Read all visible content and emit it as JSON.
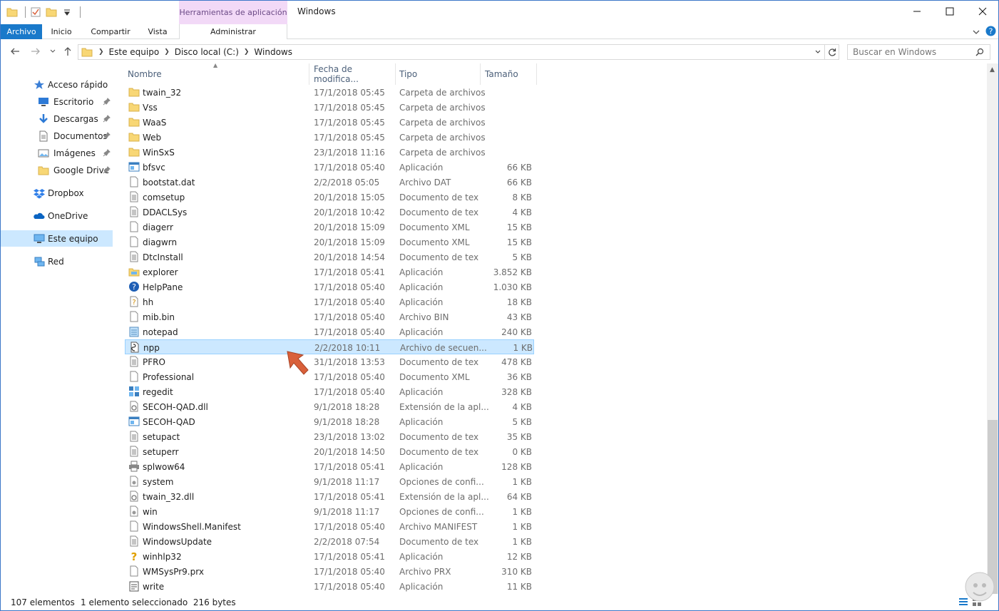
{
  "titlebar": {
    "context_tab": "Herramientas de aplicación",
    "title": "Windows"
  },
  "ribbon": {
    "tabs": [
      "Archivo",
      "Inicio",
      "Compartir",
      "Vista"
    ],
    "context_tab": "Administrar"
  },
  "address": {
    "crumbs": [
      "Este equipo",
      "Disco local (C:)",
      "Windows"
    ],
    "search_placeholder": "Buscar en Windows"
  },
  "nav": {
    "quick_access": "Acceso rápido",
    "items": [
      {
        "label": "Escritorio",
        "pinned": true,
        "icon": "desktop-icon"
      },
      {
        "label": "Descargas",
        "pinned": true,
        "icon": "download-icon"
      },
      {
        "label": "Documentos",
        "pinned": true,
        "icon": "documents-icon"
      },
      {
        "label": "Imágenes",
        "pinned": true,
        "icon": "pictures-icon"
      },
      {
        "label": "Google Drive",
        "pinned": true,
        "icon": "folder-icon"
      }
    ],
    "dropbox": "Dropbox",
    "onedrive": "OneDrive",
    "this_pc": "Este equipo",
    "network": "Red"
  },
  "columns": {
    "name": "Nombre",
    "date": "Fecha de modifica...",
    "type": "Tipo",
    "size": "Tamaño"
  },
  "files": [
    {
      "name": "twain_32",
      "date": "17/1/2018 05:45",
      "type": "Carpeta de archivos",
      "size": "",
      "icon": "folder"
    },
    {
      "name": "Vss",
      "date": "17/1/2018 05:45",
      "type": "Carpeta de archivos",
      "size": "",
      "icon": "folder"
    },
    {
      "name": "WaaS",
      "date": "17/1/2018 05:45",
      "type": "Carpeta de archivos",
      "size": "",
      "icon": "folder"
    },
    {
      "name": "Web",
      "date": "17/1/2018 05:45",
      "type": "Carpeta de archivos",
      "size": "",
      "icon": "folder"
    },
    {
      "name": "WinSxS",
      "date": "23/1/2018 11:16",
      "type": "Carpeta de archivos",
      "size": "",
      "icon": "folder"
    },
    {
      "name": "bfsvc",
      "date": "17/1/2018 05:40",
      "type": "Aplicación",
      "size": "66 KB",
      "icon": "app"
    },
    {
      "name": "bootstat.dat",
      "date": "2/2/2018 05:05",
      "type": "Archivo DAT",
      "size": "66 KB",
      "icon": "file"
    },
    {
      "name": "comsetup",
      "date": "20/1/2018 15:05",
      "type": "Documento de tex",
      "size": "8 KB",
      "icon": "text"
    },
    {
      "name": "DDACLSys",
      "date": "20/1/2018 10:42",
      "type": "Documento de tex",
      "size": "4 KB",
      "icon": "text"
    },
    {
      "name": "diagerr",
      "date": "20/1/2018 15:09",
      "type": "Documento XML",
      "size": "15 KB",
      "icon": "file"
    },
    {
      "name": "diagwrn",
      "date": "20/1/2018 15:09",
      "type": "Documento XML",
      "size": "15 KB",
      "icon": "file"
    },
    {
      "name": "DtcInstall",
      "date": "20/1/2018 14:54",
      "type": "Documento de tex",
      "size": "5 KB",
      "icon": "text"
    },
    {
      "name": "explorer",
      "date": "17/1/2018 05:41",
      "type": "Aplicación",
      "size": "3.852 KB",
      "icon": "explorer"
    },
    {
      "name": "HelpPane",
      "date": "17/1/2018 05:40",
      "type": "Aplicación",
      "size": "1.030 KB",
      "icon": "help"
    },
    {
      "name": "hh",
      "date": "17/1/2018 05:40",
      "type": "Aplicación",
      "size": "18 KB",
      "icon": "hh"
    },
    {
      "name": "mib.bin",
      "date": "17/1/2018 05:40",
      "type": "Archivo BIN",
      "size": "43 KB",
      "icon": "file"
    },
    {
      "name": "notepad",
      "date": "17/1/2018 05:40",
      "type": "Aplicación",
      "size": "240 KB",
      "icon": "notepad"
    },
    {
      "name": "npp",
      "date": "2/2/2018 10:11",
      "type": "Archivo de secuen...",
      "size": "1 KB",
      "icon": "script",
      "selected": true
    },
    {
      "name": "PFRO",
      "date": "31/1/2018 13:53",
      "type": "Documento de tex",
      "size": "478 KB",
      "icon": "text"
    },
    {
      "name": "Professional",
      "date": "17/1/2018 05:40",
      "type": "Documento XML",
      "size": "36 KB",
      "icon": "file"
    },
    {
      "name": "regedit",
      "date": "17/1/2018 05:40",
      "type": "Aplicación",
      "size": "328 KB",
      "icon": "regedit"
    },
    {
      "name": "SECOH-QAD.dll",
      "date": "9/1/2018 18:28",
      "type": "Extensión de la apl...",
      "size": "4 KB",
      "icon": "dll"
    },
    {
      "name": "SECOH-QAD",
      "date": "9/1/2018 18:28",
      "type": "Aplicación",
      "size": "5 KB",
      "icon": "app"
    },
    {
      "name": "setupact",
      "date": "23/1/2018 13:02",
      "type": "Documento de tex",
      "size": "35 KB",
      "icon": "text"
    },
    {
      "name": "setuperr",
      "date": "20/1/2018 14:50",
      "type": "Documento de tex",
      "size": "0 KB",
      "icon": "text"
    },
    {
      "name": "splwow64",
      "date": "17/1/2018 05:41",
      "type": "Aplicación",
      "size": "128 KB",
      "icon": "printer"
    },
    {
      "name": "system",
      "date": "9/1/2018 11:17",
      "type": "Opciones de confi...",
      "size": "1 KB",
      "icon": "ini"
    },
    {
      "name": "twain_32.dll",
      "date": "17/1/2018 05:41",
      "type": "Extensión de la apl...",
      "size": "64 KB",
      "icon": "dll"
    },
    {
      "name": "win",
      "date": "9/1/2018 11:17",
      "type": "Opciones de confi...",
      "size": "1 KB",
      "icon": "ini"
    },
    {
      "name": "WindowsShell.Manifest",
      "date": "17/1/2018 05:40",
      "type": "Archivo MANIFEST",
      "size": "1 KB",
      "icon": "file"
    },
    {
      "name": "WindowsUpdate",
      "date": "2/2/2018 07:54",
      "type": "Documento de tex",
      "size": "1 KB",
      "icon": "text"
    },
    {
      "name": "winhlp32",
      "date": "17/1/2018 05:41",
      "type": "Aplicación",
      "size": "12 KB",
      "icon": "winhlp"
    },
    {
      "name": "WMSysPr9.prx",
      "date": "17/1/2018 05:40",
      "type": "Archivo PRX",
      "size": "310 KB",
      "icon": "file"
    },
    {
      "name": "write",
      "date": "17/1/2018 05:40",
      "type": "Aplicación",
      "size": "11 KB",
      "icon": "write"
    }
  ],
  "status": {
    "count": "107 elementos",
    "selection": "1 elemento seleccionado  216 bytes"
  },
  "colors": {
    "accent": "#1979ca",
    "context_tab_bg": "#f2d9f7",
    "selection_bg": "#cce8ff",
    "folder": "#f8d775",
    "arrow": "#d9603a"
  }
}
